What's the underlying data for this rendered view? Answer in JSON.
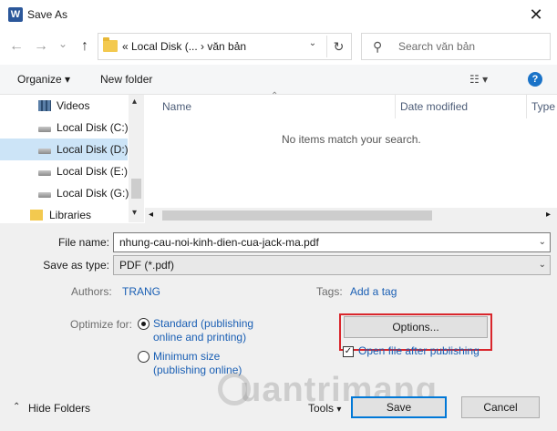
{
  "window": {
    "title": "Save As",
    "app_icon": "word-icon",
    "close_glyph": "✕"
  },
  "nav": {
    "back_glyph": "←",
    "forward_glyph": "→",
    "recent_glyph": "⌄",
    "up_glyph": "↑",
    "address": "« Local Disk (...  ›  văn bản",
    "address_dropdown": "⌄",
    "refresh_glyph": "↻",
    "search_placeholder": "Search văn bản"
  },
  "toolbar": {
    "organize": "Organize ▾",
    "new_folder": "New folder",
    "view_glyph": "☷ ▾",
    "help_glyph": "?"
  },
  "sidebar": {
    "items": [
      {
        "label": "Videos",
        "icon": "video-icon"
      },
      {
        "label": "Local Disk (C:)",
        "icon": "drive-icon"
      },
      {
        "label": "Local Disk (D:)",
        "icon": "drive-icon",
        "selected": true
      },
      {
        "label": "Local Disk (E:)",
        "icon": "drive-icon"
      },
      {
        "label": "Local Disk (G:)",
        "icon": "drive-icon"
      },
      {
        "label": "Libraries",
        "icon": "library-icon"
      }
    ]
  },
  "file_list": {
    "columns": [
      "Name",
      "Date modified",
      "Type"
    ],
    "empty_message": "No items match your search."
  },
  "form": {
    "file_name_label": "File name:",
    "file_name_value": "nhung-cau-noi-kinh-dien-cua-jack-ma.pdf",
    "save_as_type_label": "Save as type:",
    "save_as_type_value": "PDF (*.pdf)",
    "authors_label": "Authors:",
    "authors_value": "TRANG",
    "tags_label": "Tags:",
    "tags_value": "Add a tag",
    "optimize_label": "Optimize for:",
    "optimize_standard_line1": "Standard (publishing",
    "optimize_standard_line2": "online and printing)",
    "optimize_minimum_line1": "Minimum size",
    "optimize_minimum_line2": "(publishing online)",
    "options_button": "Options...",
    "open_after_label": "Open file after publishing"
  },
  "footer": {
    "hide_folders": "Hide Folders",
    "tools": "Tools",
    "save": "Save",
    "cancel": "Cancel"
  },
  "colors": {
    "accent": "#0078d7",
    "link": "#1a5fb4",
    "highlight_box": "#d9262c",
    "selection": "#cce4f7"
  }
}
